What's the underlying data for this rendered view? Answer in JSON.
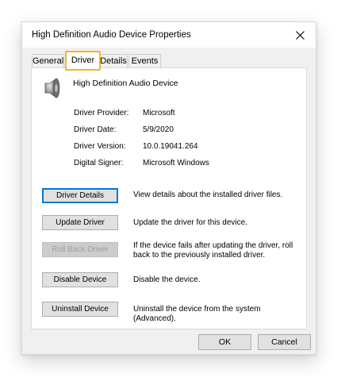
{
  "window": {
    "title": "High Definition Audio Device Properties"
  },
  "tabs": [
    {
      "label": "General"
    },
    {
      "label": "Driver",
      "active": true
    },
    {
      "label": "Details"
    },
    {
      "label": "Events"
    }
  ],
  "device": {
    "name": "High Definition Audio Device",
    "icon": "speaker-icon"
  },
  "info": [
    {
      "label": "Driver Provider:",
      "value": "Microsoft"
    },
    {
      "label": "Driver Date:",
      "value": "5/9/2020"
    },
    {
      "label": "Driver Version:",
      "value": "10.0.19041.264"
    },
    {
      "label": "Digital Signer:",
      "value": "Microsoft Windows"
    }
  ],
  "actions": [
    {
      "label": "Driver Details",
      "description": "View details about the installed driver files."
    },
    {
      "label": "Update Driver",
      "description": "Update the driver for this device."
    },
    {
      "label": "Roll Back Driver",
      "description": "If the device fails after updating the driver, roll back to the previously installed driver.",
      "disabled": true
    },
    {
      "label": "Disable Device",
      "description": "Disable the device."
    },
    {
      "label": "Uninstall Device",
      "description": "Uninstall the device from the system (Advanced)."
    }
  ],
  "footer": {
    "ok_label": "OK",
    "cancel_label": "Cancel"
  },
  "colors": {
    "highlight": "#f5b623",
    "focus": "#0078d7"
  }
}
